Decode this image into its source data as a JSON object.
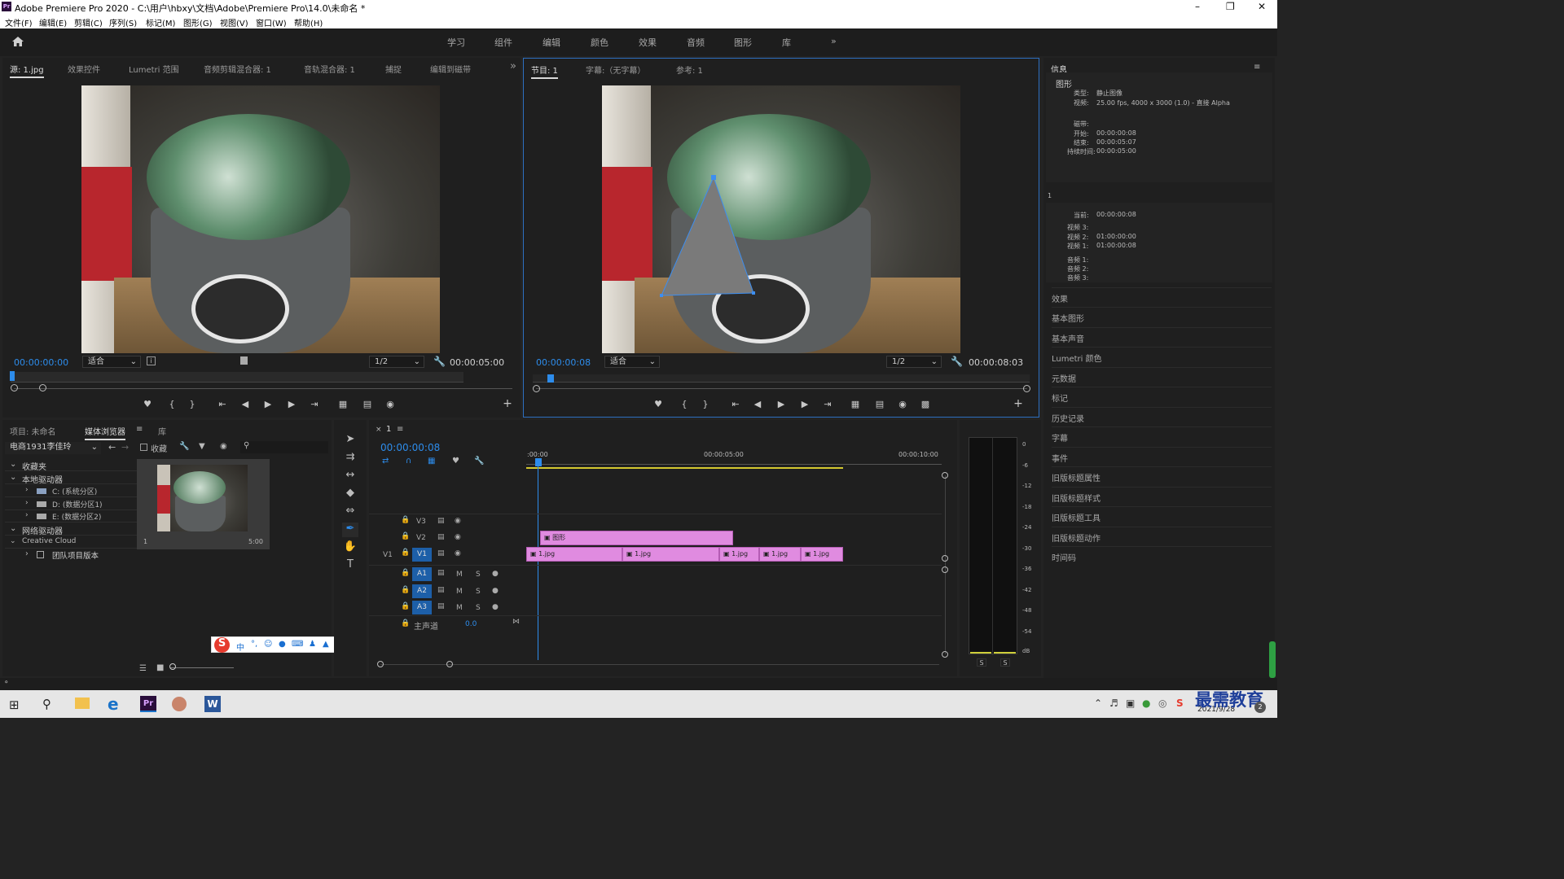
{
  "window": {
    "title": "Adobe Premiere Pro 2020 - C:\\用户\\hbxy\\文档\\Adobe\\Premiere Pro\\14.0\\未命名 *",
    "app_icon": "Pr"
  },
  "menu": [
    "文件(F)",
    "编辑(E)",
    "剪辑(C)",
    "序列(S)",
    "标记(M)",
    "图形(G)",
    "视图(V)",
    "窗口(W)",
    "帮助(H)"
  ],
  "workspaces": [
    "学习",
    "组件",
    "编辑",
    "颜色",
    "效果",
    "音频",
    "图形",
    "库"
  ],
  "source_panel": {
    "tabs": [
      "源: 1.jpg",
      "效果控件",
      "Lumetri 范围",
      "音频剪辑混合器: 1",
      "音轨混合器: 1",
      "捕捉",
      "编辑到磁带"
    ],
    "timecode": "00:00:00:00",
    "fit": "适合",
    "resolution": "1/2",
    "duration": "00:00:05:00"
  },
  "program_panel": {
    "tabs": [
      "节目: 1",
      "字幕:（无字幕）",
      "参考: 1"
    ],
    "timecode": "00:00:00:08",
    "fit": "适合",
    "resolution": "1/2",
    "duration": "00:00:08:03"
  },
  "info_panel": {
    "title": "信息",
    "section": "图形",
    "type_label": "类型:",
    "type_value": "静止图像",
    "video_label": "视频:",
    "video_value": "25.00 fps, 4000 x 3000 (1.0) - 直接 Alpha",
    "tape_label": "磁带:",
    "start_label": "开始:",
    "start_value": "00:00:00:08",
    "end_label": "结束:",
    "end_value": "00:00:05:07",
    "dur_label": "持续时间:",
    "dur_value": "00:00:05:00",
    "seq_name": "1",
    "current_label": "当前:",
    "current_value": "00:00:00:08",
    "v3": "视频 3:",
    "v2": "视频 2:",
    "v2_value": "01:00:00:00",
    "v1": "视频 1:",
    "v1_value": "01:00:00:08",
    "a1": "音频 1:",
    "a2": "音频 2:",
    "a3": "音频 3:"
  },
  "right_panels": [
    "效果",
    "基本图形",
    "基本声音",
    "Lumetri 颜色",
    "元数据",
    "标记",
    "历史记录",
    "字幕",
    "事件",
    "旧版标题属性",
    "旧版标题样式",
    "旧版标题工具",
    "旧版标题动作",
    "时间码"
  ],
  "project_panel": {
    "tabs": [
      "项目: 未命名",
      "媒体浏览器",
      "库"
    ],
    "location": "电商1931李佳玲",
    "favorites_label": "收藏",
    "tree": [
      "收藏夹",
      "本地驱动器",
      "C: (系统分区)",
      "D: (数据分区1)",
      "E: (数据分区2)",
      "网络驱动器",
      "Creative Cloud",
      "团队项目版本"
    ],
    "thumb_name": "1",
    "thumb_dur": "5:00"
  },
  "timeline": {
    "tab": "1",
    "timecode": "00:00:00:08",
    "ruler": [
      ":00:00",
      "00:00:05:00",
      "00:00:10:00"
    ],
    "tracks": {
      "V3": "V3",
      "V2": "V2",
      "V1": "V1",
      "A1": "A1",
      "A2": "A2",
      "A3": "A3",
      "master": "主声道",
      "master_val": "0.0"
    },
    "graphic_clip": "图形",
    "v1_clips": [
      "1.jpg",
      "1.jpg",
      "1.jpg",
      "1.jpg",
      "1.jpg"
    ]
  },
  "audio_meter": {
    "scale": [
      "0",
      "-6",
      "-12",
      "-18",
      "-24",
      "-30",
      "-36",
      "-42",
      "-48",
      "-54",
      "dB"
    ],
    "solo": [
      "S",
      "S"
    ]
  },
  "taskbar": {
    "date": "2021/9/28",
    "watermark": "最需教育"
  },
  "colors": {
    "accent": "#2d8ceb",
    "clip": "#e08be0",
    "panel": "#1f1f1f"
  }
}
